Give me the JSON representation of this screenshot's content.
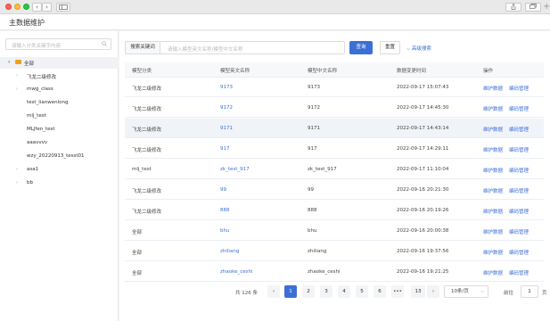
{
  "browser": {
    "back_glyph": "‹",
    "fwd_glyph": "›",
    "plus_glyph": "+"
  },
  "page": {
    "title": "主数据维护"
  },
  "sidebar": {
    "search_placeholder": "请输入分类关键字内容",
    "search_icon": "search-icon",
    "items": [
      {
        "label": "全部",
        "caret": "▾",
        "folder": true,
        "selected": true,
        "level": 0
      },
      {
        "label": "飞龙二级修改",
        "caret": "›",
        "level": 1
      },
      {
        "label": "mwg_class",
        "caret": "›",
        "level": 1
      },
      {
        "label": "test_lianwenlong",
        "caret": "",
        "level": 1
      },
      {
        "label": "mlj_test",
        "caret": "",
        "level": 1
      },
      {
        "label": "MLJfen_test",
        "caret": "",
        "level": 1
      },
      {
        "label": "aaavvvv",
        "caret": "",
        "level": 1
      },
      {
        "label": "wzy_20220913_tesst01",
        "caret": "",
        "level": 1
      },
      {
        "label": "asa1",
        "caret": "›",
        "level": 1
      },
      {
        "label": "bb",
        "caret": "›",
        "level": 1
      }
    ]
  },
  "search": {
    "label": "搜索关键词",
    "placeholder": "请输入模型英文名称/模型中文名称",
    "query_button": "查询",
    "reset_button": "重置",
    "advanced": "⌵ 高级搜索"
  },
  "table": {
    "headers": [
      "模型分类",
      "模型英文名称",
      "模型中文名称",
      "数据变更时间",
      "操作"
    ],
    "action_maintain": "维护数据",
    "action_code": "编码管理",
    "rows": [
      {
        "category": "飞龙二级修改",
        "en": "9173",
        "cn": "9173",
        "time": "2022-09-17 15:07:43",
        "hl": false
      },
      {
        "category": "飞龙二级修改",
        "en": "9172",
        "cn": "9172",
        "time": "2022-09-17 14:45:30",
        "hl": false
      },
      {
        "category": "飞龙二级修改",
        "en": "9171",
        "cn": "9171",
        "time": "2022-09-17 14:43:14",
        "hl": true
      },
      {
        "category": "飞龙二级修改",
        "en": "917",
        "cn": "917",
        "time": "2022-09-17 14:29:11",
        "hl": false
      },
      {
        "category": "mlj_test",
        "en": "zk_test_917",
        "cn": "zk_test_917",
        "time": "2022-09-17 11:10:04",
        "hl": false
      },
      {
        "category": "飞龙二级修改",
        "en": "99",
        "cn": "99",
        "time": "2022-09-16 20:21:30",
        "hl": false
      },
      {
        "category": "飞龙二级修改",
        "en": "888",
        "cn": "888",
        "time": "2022-09-16 20:19:26",
        "hl": false
      },
      {
        "category": "全部",
        "en": "bhu",
        "cn": "bhu",
        "time": "2022-09-16 20:00:38",
        "hl": false
      },
      {
        "category": "全部",
        "en": "zhiliang",
        "cn": "zhiliang",
        "time": "2022-09-16 19:37:56",
        "hl": false
      },
      {
        "category": "全部",
        "en": "zhaoke_ceshi",
        "cn": "zhaoke_ceshi",
        "time": "2022-09-16 19:21:25",
        "hl": false
      }
    ]
  },
  "pagination": {
    "total": "共 126 条",
    "prev": "‹",
    "next": "›",
    "pages": [
      "1",
      "2",
      "3",
      "4",
      "5",
      "6",
      "•••",
      "13"
    ],
    "current": "1",
    "page_size": "10条/页",
    "page_size_caret": "⌵",
    "goto_label": "前往",
    "goto_value": "1",
    "page_label": "页"
  },
  "colors": {
    "primary": "#3c6fd6",
    "folder": "#f0a020",
    "selected_bg": "#f0f2f5",
    "row_highlight": "#f0f3f8"
  }
}
